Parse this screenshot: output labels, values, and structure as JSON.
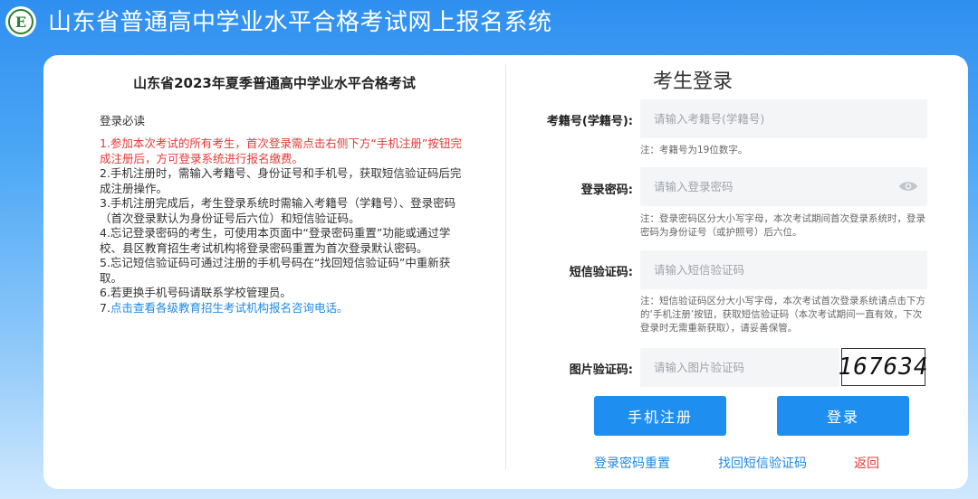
{
  "header": {
    "logo_letter": "E",
    "title": "山东省普通高中学业水平合格考试网上报名系统"
  },
  "notice": {
    "title": "山东省2023年夏季普通高中学业水平合格考试",
    "heading": "登录必读",
    "items": [
      "1.参加本次考试的所有考生，首次登录需点击右侧下方“手机注册”按钮完成注册后，方可登录系统进行报名缴费。",
      "2.手机注册时，需输入考籍号、身份证号和手机号，获取短信验证码后完成注册操作。",
      "3.手机注册完成后，考生登录系统时需输入考籍号（学籍号）、登录密码（首次登录默认为身份证号后六位）和短信验证码。",
      "4.忘记登录密码的考生，可使用本页面中“登录密码重置”功能或通过学校、县区教育招生考试机构将登录密码重置为首次登录默认密码。",
      "5.忘记短信验证码可通过注册的手机号码在“找回短信验证码”中重新获取。",
      "6.若更换手机号码请联系学校管理员。"
    ],
    "item7_prefix": "7.",
    "item7_link": "点击查看各级教育招生考试机构报名咨询电话。"
  },
  "login": {
    "title": "考生登录",
    "exam_id_label": "考籍号(学籍号):",
    "exam_id_placeholder": "请输入考籍号(学籍号)",
    "exam_id_note": "注：考籍号为19位数字。",
    "password_label": "登录密码:",
    "password_placeholder": "请输入登录密码",
    "password_note": "注：登录密码区分大小写字母，本次考试期间首次登录系统时，登录密码为身份证号（或护照号）后六位。",
    "sms_label": "短信验证码:",
    "sms_placeholder": "请输入短信验证码",
    "sms_note": "注：短信验证码区分大小写字母，本次考试首次登录系统请点击下方的‘手机注册’按钮，获取短信验证码（本次考试期间一直有效，下次登录时无需重新获取），请妥善保管。",
    "captcha_label": "图片验证码:",
    "captcha_placeholder": "请输入图片验证码",
    "captcha_text": "167634",
    "register_button": "手机注册",
    "login_button": "登录",
    "reset_password_link": "登录密码重置",
    "recover_sms_link": "找回短信验证码",
    "back_link": "返回"
  },
  "colors": {
    "primary": "#1e8ff0",
    "link": "#1e88e5",
    "danger": "#e53935"
  }
}
